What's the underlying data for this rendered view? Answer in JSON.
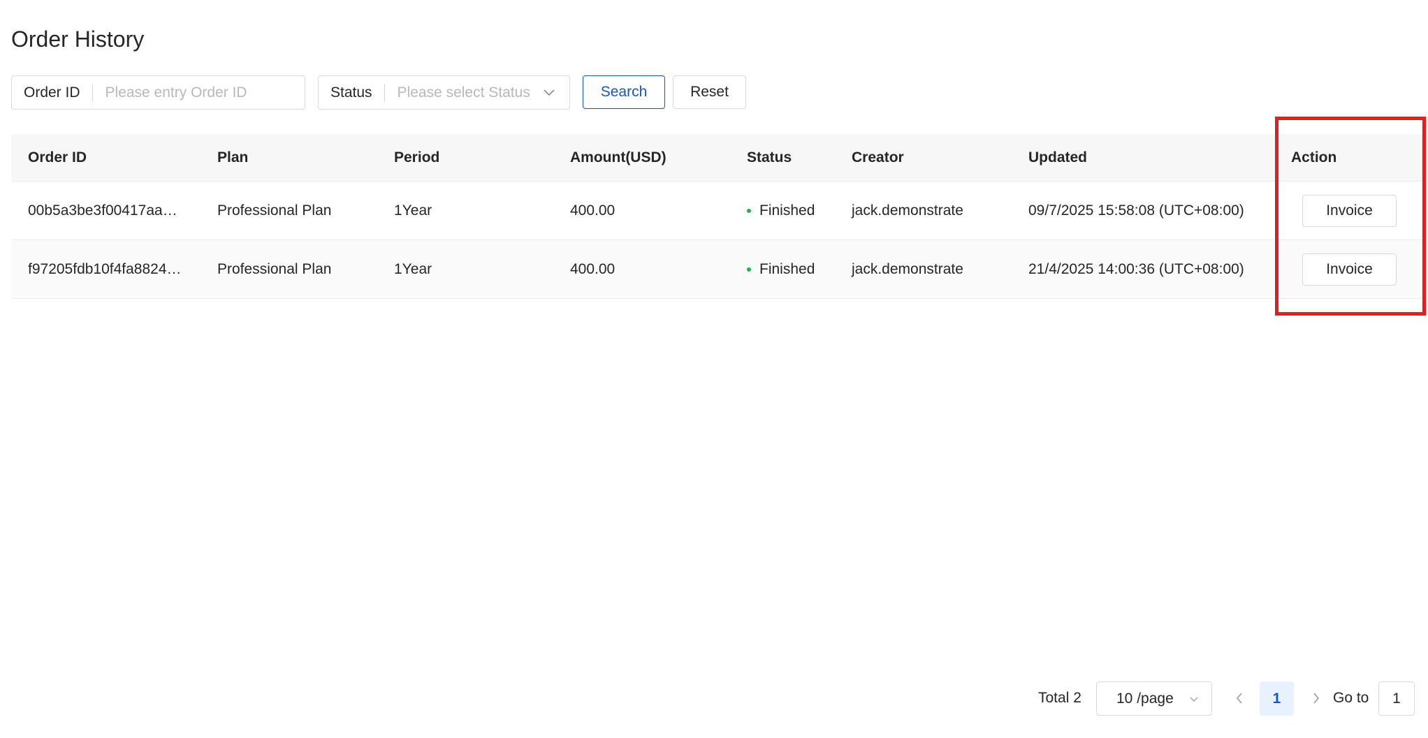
{
  "page": {
    "title": "Order History"
  },
  "filters": {
    "order_id": {
      "label": "Order ID",
      "placeholder": "Please entry Order ID"
    },
    "status": {
      "label": "Status",
      "placeholder": "Please select Status"
    },
    "search_label": "Search",
    "reset_label": "Reset"
  },
  "table": {
    "columns": [
      "Order ID",
      "Plan",
      "Period",
      "Amount(USD)",
      "Status",
      "Creator",
      "Updated",
      "Action"
    ],
    "rows": [
      {
        "order_id": "00b5a3be3f00417aa…",
        "plan": "Professional Plan",
        "period": "1Year",
        "amount": "400.00",
        "status": "Finished",
        "creator": "jack.demonstrate",
        "updated": "09/7/2025 15:58:08 (UTC+08:00)",
        "action": "Invoice"
      },
      {
        "order_id": "f97205fdb10f4fa8824…",
        "plan": "Professional Plan",
        "period": "1Year",
        "amount": "400.00",
        "status": "Finished",
        "creator": "jack.demonstrate",
        "updated": "21/4/2025 14:00:36 (UTC+08:00)",
        "action": "Invoice"
      }
    ]
  },
  "pagination": {
    "total": "Total 2",
    "page_size": "10 /page",
    "current_page": "1",
    "goto_label": "Go to",
    "goto_value": "1"
  },
  "colors": {
    "primary": "#1456c9",
    "status_finished": "#22b14c",
    "highlight": "#e02020"
  }
}
